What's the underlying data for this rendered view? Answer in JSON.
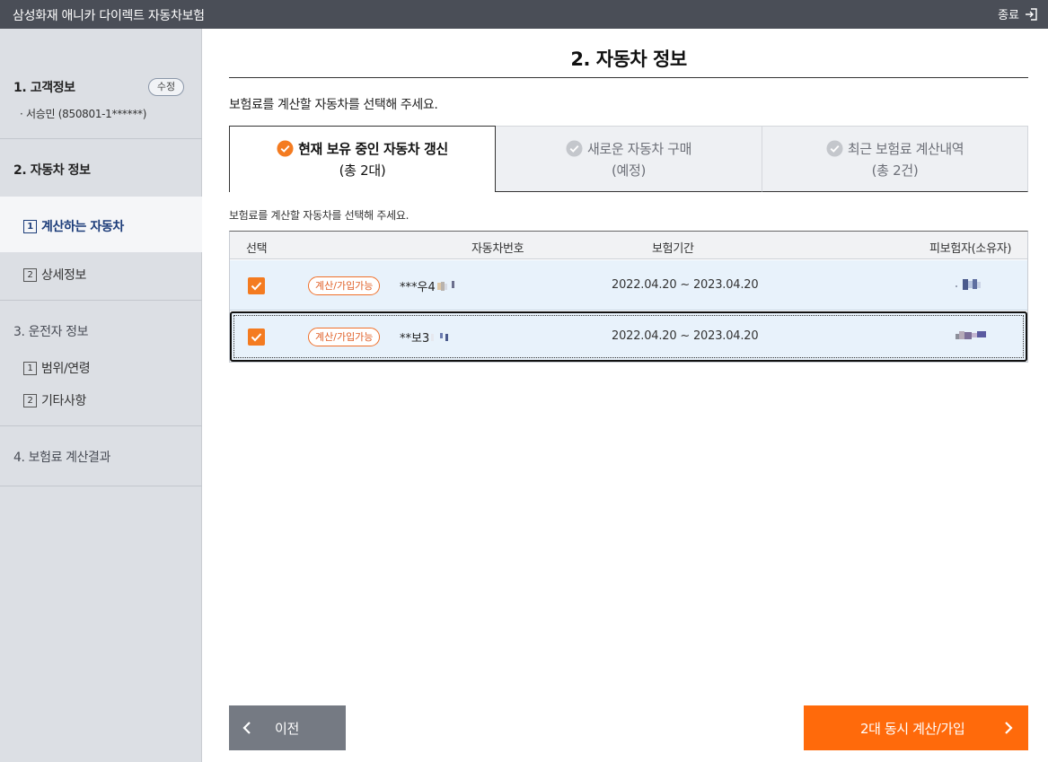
{
  "app": {
    "title": "삼성화재 애니카 다이렉트 자동차보험",
    "exit_label": "종료"
  },
  "sidebar": {
    "sections": [
      {
        "title": "1. 고객정보",
        "edit_label": "수정",
        "info": "· 서승민 (850801-1******)"
      },
      {
        "title": "2. 자동차 정보",
        "subitems": [
          {
            "num": "1",
            "label": "계산하는 자동차"
          },
          {
            "num": "2",
            "label": "상세정보"
          }
        ]
      },
      {
        "title": "3. 운전자 정보",
        "subitems": [
          {
            "num": "1",
            "label": "범위/연령"
          },
          {
            "num": "2",
            "label": "기타사항"
          }
        ]
      },
      {
        "title": "4. 보험료 계산결과"
      }
    ]
  },
  "main": {
    "title": "2. 자동차 정보",
    "instruction": "보험료를 계산할 자동차를 선택해 주세요.",
    "sub_instruction": "보험료를 계산할 자동차를 선택해 주세요.",
    "tabs": [
      {
        "label": "현재 보유 중인 자동차 갱신",
        "sub": "(총 2대)"
      },
      {
        "label": "새로운 자동차 구매",
        "sub": "(예정)"
      },
      {
        "label": "최근 보험료 계산내역",
        "sub": "(총 2건)"
      }
    ],
    "table": {
      "headers": {
        "select": "선택",
        "plate": "자동차번호",
        "period": "보험기간",
        "owner": "피보험자(소유자)"
      },
      "rows": [
        {
          "badge": "계산/가입가능",
          "plate": "***우4",
          "period": "2022.04.20 ~ 2023.04.20"
        },
        {
          "badge": "계산/가입가능",
          "plate": "**보3",
          "period": "2022.04.20 ~ 2023.04.20"
        }
      ]
    }
  },
  "buttons": {
    "prev_label": "이전",
    "next_label": "2대 동시 계산/가입"
  },
  "colors": {
    "accent_orange": "#ff6a0b",
    "topbar": "#4a4e57",
    "sidebar": "#dcdfe4",
    "active_navy": "#1d3d7a",
    "row_highlight": "#e8f2fb"
  }
}
